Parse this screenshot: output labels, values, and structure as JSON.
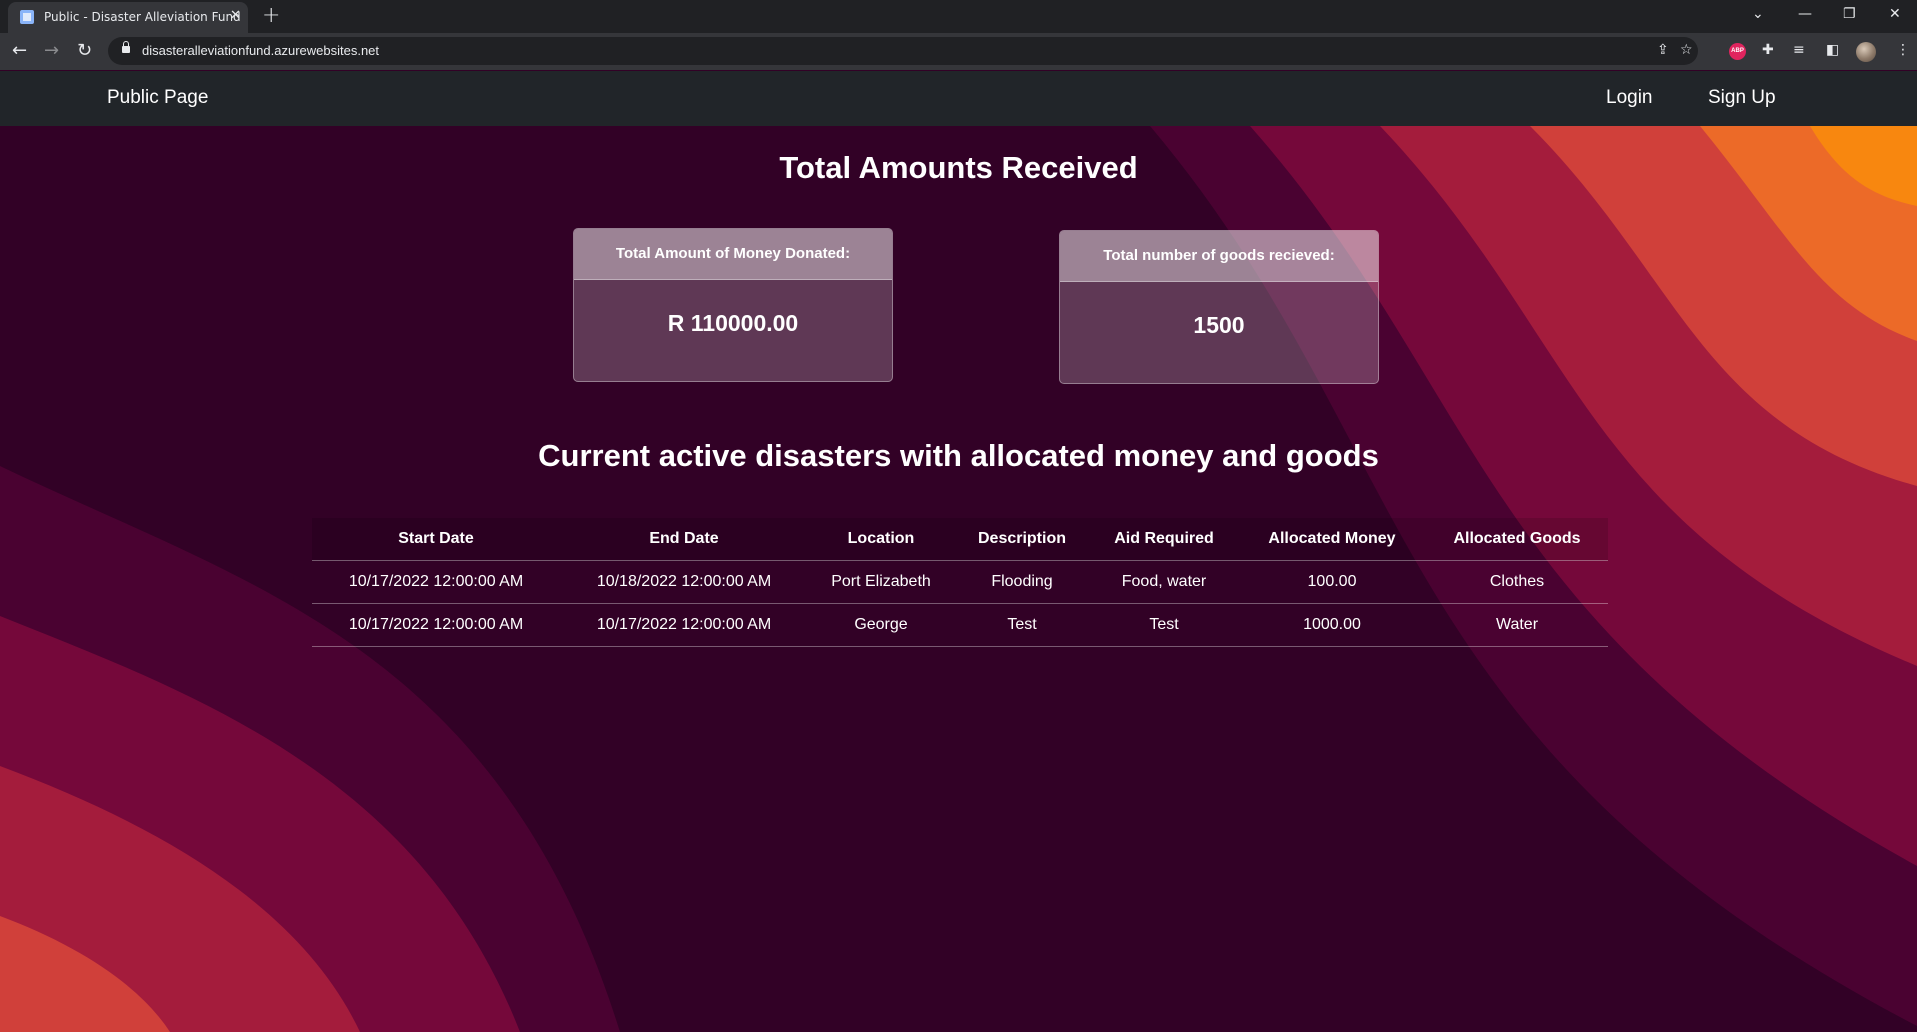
{
  "browser": {
    "tab_title": "Public - Disaster Alleviation Fund",
    "url": "disasteralleviationfund.azurewebsites.net"
  },
  "navbar": {
    "brand": "Public Page",
    "login": "Login",
    "signup": "Sign Up"
  },
  "totals": {
    "heading": "Total Amounts Received",
    "money_label": "Total Amount of Money Donated:",
    "money_value": "R 110000.00",
    "goods_label": "Total number of goods recieved:",
    "goods_value": "1500"
  },
  "disasters": {
    "heading": "Current active disasters with allocated money and goods",
    "columns": [
      "Start Date",
      "End Date",
      "Location",
      "Description",
      "Aid Required",
      "Allocated Money",
      "Allocated Goods"
    ],
    "rows": [
      [
        "10/17/2022 12:00:00 AM",
        "10/18/2022 12:00:00 AM",
        "Port Elizabeth",
        "Flooding",
        "Food, water",
        "100.00",
        "Clothes"
      ],
      [
        "10/17/2022 12:00:00 AM",
        "10/17/2022 12:00:00 AM",
        "George",
        "Test",
        "Test",
        "1000.00",
        "Water"
      ]
    ]
  },
  "colors": {
    "background_base": "#320126",
    "wave_1": "#4a0231",
    "wave_2": "#75083a",
    "wave_3": "#a41c3c",
    "wave_4": "#d0403a",
    "wave_5": "#ec6a28",
    "wave_6": "#f8870f"
  }
}
